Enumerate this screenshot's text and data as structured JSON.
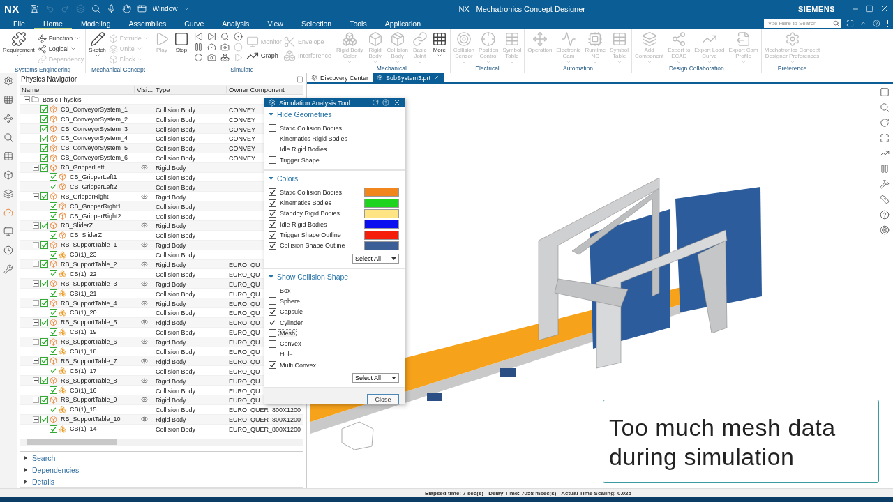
{
  "title_bar": {
    "logo": "NX",
    "window_menu": "Window",
    "title": "NX - Mechatronics Concept Designer",
    "brand": "SIEMENS"
  },
  "menu_tabs": [
    {
      "label": "File",
      "selected": false
    },
    {
      "label": "Home",
      "selected": true
    },
    {
      "label": "Modeling",
      "selected": false
    },
    {
      "label": "Assemblies",
      "selected": false
    },
    {
      "label": "Curve",
      "selected": false
    },
    {
      "label": "Analysis",
      "selected": false
    },
    {
      "label": "View",
      "selected": false
    },
    {
      "label": "Selection",
      "selected": false
    },
    {
      "label": "Tools",
      "selected": false
    },
    {
      "label": "Application",
      "selected": false
    }
  ],
  "search": {
    "placeholder": "Type Here to Search"
  },
  "ribbon": [
    {
      "group": "Systems Engineering",
      "items": [
        {
          "kind": "large",
          "label": "Requirement",
          "dropdown": true,
          "disabled": false
        },
        {
          "kind": "stack",
          "buttons": [
            {
              "label": "Function",
              "dropdown": true,
              "disabled": false
            },
            {
              "label": "Logical",
              "dropdown": true,
              "disabled": false
            },
            {
              "label": "Dependency",
              "dropdown": false,
              "disabled": true
            }
          ]
        }
      ]
    },
    {
      "group": "Mechanical Concept",
      "items": [
        {
          "kind": "large",
          "label": "Sketch",
          "dropdown": true,
          "disabled": false
        },
        {
          "kind": "stack",
          "buttons": [
            {
              "label": "Extrude",
              "dropdown": true,
              "disabled": true
            },
            {
              "label": "Unite",
              "dropdown": true,
              "disabled": true
            },
            {
              "label": "Block",
              "dropdown": true,
              "disabled": true
            }
          ]
        }
      ]
    },
    {
      "group": "Simulate",
      "items": [
        {
          "kind": "large",
          "label": "Play",
          "dropdown": false,
          "disabled": true
        },
        {
          "kind": "large",
          "label": "Stop",
          "dropdown": false,
          "disabled": false
        },
        {
          "kind": "icon_grid"
        },
        {
          "kind": "stack",
          "buttons": [
            {
              "label": "Monitor",
              "dropdown": false,
              "disabled": true
            },
            {
              "label": "Graph",
              "dropdown": false,
              "disabled": false
            }
          ]
        },
        {
          "kind": "stack",
          "buttons": [
            {
              "label": "Envelope",
              "dropdown": false,
              "disabled": true
            },
            {
              "label": "Interference",
              "dropdown": false,
              "disabled": true
            }
          ]
        }
      ]
    },
    {
      "group": "Mechanical",
      "items": [
        {
          "kind": "large",
          "label": "Rigid Body\nColor",
          "dropdown": true,
          "disabled": true
        },
        {
          "kind": "large",
          "label": "Rigid\nBody",
          "dropdown": true,
          "disabled": true
        },
        {
          "kind": "large",
          "label": "Collision\nBody",
          "dropdown": true,
          "disabled": true
        },
        {
          "kind": "large",
          "label": "Basic\nJoint",
          "dropdown": true,
          "disabled": true
        },
        {
          "kind": "large",
          "label": "More",
          "dropdown": true,
          "disabled": false
        }
      ]
    },
    {
      "group": "Electrical",
      "items": [
        {
          "kind": "large",
          "label": "Collision\nSensor",
          "dropdown": true,
          "disabled": true
        },
        {
          "kind": "large",
          "label": "Position\nControl",
          "dropdown": true,
          "disabled": true
        },
        {
          "kind": "large",
          "label": "Symbol\nTable",
          "dropdown": true,
          "disabled": true
        }
      ]
    },
    {
      "group": "Automation",
      "items": [
        {
          "kind": "large",
          "label": "Operation",
          "dropdown": true,
          "disabled": true
        },
        {
          "kind": "large",
          "label": "Electronic\nCam",
          "dropdown": true,
          "disabled": true
        },
        {
          "kind": "large",
          "label": "Runtime\nNC",
          "dropdown": true,
          "disabled": true
        },
        {
          "kind": "large",
          "label": "Symbol\nTable",
          "dropdown": true,
          "disabled": true
        }
      ]
    },
    {
      "group": "Design Collaboration",
      "items": [
        {
          "kind": "large",
          "label": "Add\nComponent",
          "dropdown": true,
          "disabled": true
        },
        {
          "kind": "large",
          "label": "Export to\nECAD",
          "dropdown": true,
          "disabled": true
        },
        {
          "kind": "large",
          "label": "Export Load\nCurve",
          "dropdown": true,
          "disabled": true
        },
        {
          "kind": "large",
          "label": "Export Cam\nProfile",
          "dropdown": true,
          "disabled": true
        }
      ]
    },
    {
      "group": "Preference",
      "items": [
        {
          "kind": "large",
          "label": "Mechatronics Concept\nDesigner Preferences",
          "dropdown": true,
          "disabled": true
        }
      ]
    }
  ],
  "navigator": {
    "title": "Physics Navigator",
    "columns": [
      "Name",
      "Visi...",
      "Type",
      "Owner Component"
    ],
    "tree": [
      {
        "name": "Basic Physics",
        "kind": "folder",
        "expanded": true,
        "children": [
          {
            "name": "CB_ConveyorSystem_1",
            "kind": "collision",
            "type": "Collision Body",
            "owner": "CONVEY",
            "checked": true
          },
          {
            "name": "CB_ConveyorSystem_2",
            "kind": "collision",
            "type": "Collision Body",
            "owner": "CONVEY",
            "checked": true
          },
          {
            "name": "CB_ConveyorSystem_3",
            "kind": "collision",
            "type": "Collision Body",
            "owner": "CONVEY",
            "checked": true
          },
          {
            "name": "CB_ConveyorSystem_4",
            "kind": "collision",
            "type": "Collision Body",
            "owner": "CONVEY",
            "checked": true
          },
          {
            "name": "CB_ConveyorSystem_5",
            "kind": "collision",
            "type": "Collision Body",
            "owner": "CONVEY",
            "checked": true
          },
          {
            "name": "CB_ConveyorSystem_6",
            "kind": "collision",
            "type": "Collision Body",
            "owner": "CONVEY",
            "checked": true
          },
          {
            "name": "RB_GripperLeft",
            "kind": "rigid",
            "type": "Rigid Body",
            "checked": true,
            "expanded": true,
            "children": [
              {
                "name": "CB_GripperLeft1",
                "kind": "collision",
                "type": "Collision Body",
                "checked": true
              },
              {
                "name": "CB_GripperLeft2",
                "kind": "collision",
                "type": "Collision Body",
                "checked": true
              }
            ]
          },
          {
            "name": "RB_GripperRight",
            "kind": "rigid",
            "type": "Rigid Body",
            "checked": true,
            "expanded": true,
            "children": [
              {
                "name": "CB_GripperRight1",
                "kind": "collision",
                "type": "Collision Body",
                "checked": true
              },
              {
                "name": "CB_GripperRight2",
                "kind": "collision",
                "type": "Collision Body",
                "checked": true
              }
            ]
          },
          {
            "name": "RB_SliderZ",
            "kind": "rigid",
            "type": "Rigid Body",
            "checked": true,
            "expanded": true,
            "children": [
              {
                "name": "CB_SliderZ",
                "kind": "collision",
                "type": "Collision Body",
                "checked": true
              }
            ]
          },
          {
            "name": "RB_SupportTable_1",
            "kind": "rigid",
            "type": "Rigid Body",
            "checked": true,
            "expanded": true,
            "children": [
              {
                "name": "CB(1)_23",
                "kind": "mesh",
                "type": "Collision Body",
                "checked": true
              }
            ]
          },
          {
            "name": "RB_SupportTable_2",
            "kind": "rigid",
            "type": "Rigid Body",
            "owner": "EURO_QU",
            "checked": true,
            "expanded": true,
            "children": [
              {
                "name": "CB(1)_22",
                "kind": "mesh",
                "type": "Collision Body",
                "owner": "EURO_QU",
                "checked": true
              }
            ]
          },
          {
            "name": "RB_SupportTable_3",
            "kind": "rigid",
            "type": "Rigid Body",
            "owner": "EURO_QU",
            "checked": true,
            "expanded": true,
            "children": [
              {
                "name": "CB(1)_21",
                "kind": "mesh",
                "type": "Collision Body",
                "owner": "EURO_QU",
                "checked": true
              }
            ]
          },
          {
            "name": "RB_SupportTable_4",
            "kind": "rigid",
            "type": "Rigid Body",
            "owner": "EURO_QU",
            "checked": true,
            "expanded": true,
            "children": [
              {
                "name": "CB(1)_20",
                "kind": "mesh",
                "type": "Collision Body",
                "owner": "EURO_QU",
                "checked": true
              }
            ]
          },
          {
            "name": "RB_SupportTable_5",
            "kind": "rigid",
            "type": "Rigid Body",
            "owner": "EURO_QU",
            "checked": true,
            "expanded": true,
            "children": [
              {
                "name": "CB(1)_19",
                "kind": "mesh",
                "type": "Collision Body",
                "owner": "EURO_QU",
                "checked": true
              }
            ]
          },
          {
            "name": "RB_SupportTable_6",
            "kind": "rigid",
            "type": "Rigid Body",
            "owner": "EURO_QU",
            "checked": true,
            "expanded": true,
            "children": [
              {
                "name": "CB(1)_18",
                "kind": "mesh",
                "type": "Collision Body",
                "owner": "EURO_QU",
                "checked": true
              }
            ]
          },
          {
            "name": "RB_SupportTable_7",
            "kind": "rigid",
            "type": "Rigid Body",
            "owner": "EURO_QU",
            "checked": true,
            "expanded": true,
            "children": [
              {
                "name": "CB(1)_17",
                "kind": "mesh",
                "type": "Collision Body",
                "owner": "EURO_QU",
                "checked": true
              }
            ]
          },
          {
            "name": "RB_SupportTable_8",
            "kind": "rigid",
            "type": "Rigid Body",
            "owner": "EURO_QU",
            "checked": true,
            "expanded": true,
            "children": [
              {
                "name": "CB(1)_16",
                "kind": "mesh",
                "type": "Collision Body",
                "owner": "EURO_QU",
                "checked": true
              }
            ]
          },
          {
            "name": "RB_SupportTable_9",
            "kind": "rigid",
            "type": "Rigid Body",
            "owner": "EURO_QU",
            "checked": true,
            "expanded": true,
            "children": [
              {
                "name": "CB(1)_15",
                "kind": "mesh",
                "type": "Collision Body",
                "owner": "EURO_QUER_800X1200",
                "checked": true
              }
            ]
          },
          {
            "name": "RB_SupportTable_10",
            "kind": "rigid",
            "type": "Rigid Body",
            "owner": "EURO_QUER_800X1200",
            "checked": true,
            "expanded": true,
            "children": [
              {
                "name": "CB(1)_14",
                "kind": "mesh",
                "type": "Collision Body",
                "owner": "EURO_QUER_800X1200",
                "checked": true
              }
            ]
          }
        ]
      }
    ],
    "sections": [
      {
        "label": "Search",
        "expanded": false
      },
      {
        "label": "Dependencies",
        "expanded": false
      },
      {
        "label": "Details",
        "expanded": false
      }
    ]
  },
  "viewport_tabs": [
    {
      "label": "Discovery Center",
      "selected": false
    },
    {
      "label": "SubSystem3.prt",
      "selected": true
    }
  ],
  "dialog": {
    "title": "Simulation Analysis Tool",
    "sections": [
      {
        "title": "Hide Geometries",
        "expanded": true,
        "items": [
          {
            "label": "Static Collision Bodies",
            "checked": false
          },
          {
            "label": "Kinematics Rigid Bodies",
            "checked": false
          },
          {
            "label": "Idle Rigid Bodies",
            "checked": false
          },
          {
            "label": "Trigger Shape",
            "checked": false
          }
        ]
      },
      {
        "title": "Colors",
        "expanded": true,
        "select": "Select All",
        "items": [
          {
            "label": "Static Collision Bodies",
            "checked": true,
            "color": "#f0861c"
          },
          {
            "label": "Kinematics Bodies",
            "checked": true,
            "color": "#1ed41e"
          },
          {
            "label": "Standby Rigid Bodies",
            "checked": true,
            "color": "#ffe484"
          },
          {
            "label": "Idle Rigid Bodies",
            "checked": true,
            "color": "#0a10f0"
          },
          {
            "label": "Trigger Shape Outline",
            "checked": true,
            "color": "#f51e0a"
          },
          {
            "label": "Collision Shape Outline",
            "checked": true,
            "color": "#3b5e96"
          }
        ]
      },
      {
        "title": "Show Collision Shape",
        "expanded": true,
        "select": "Select All",
        "items": [
          {
            "label": "Box",
            "checked": false,
            "focused": false
          },
          {
            "label": "Sphere",
            "checked": false,
            "focused": false
          },
          {
            "label": "Capsule",
            "checked": true,
            "focused": false
          },
          {
            "label": "Cylinder",
            "checked": true,
            "focused": false
          },
          {
            "label": "Mesh",
            "checked": false,
            "focused": true
          },
          {
            "label": "Convex",
            "checked": false,
            "focused": false
          },
          {
            "label": "Hole",
            "checked": false,
            "focused": false
          },
          {
            "label": "Multi Convex",
            "checked": true,
            "focused": false
          }
        ]
      }
    ],
    "close": "Close"
  },
  "caption": "Too much mesh data during simulation",
  "status_bar": "Elapsed time: 7 sec(s) - Delay Time: 7058 msec(s) - Actual Time Scaling: 0.025"
}
